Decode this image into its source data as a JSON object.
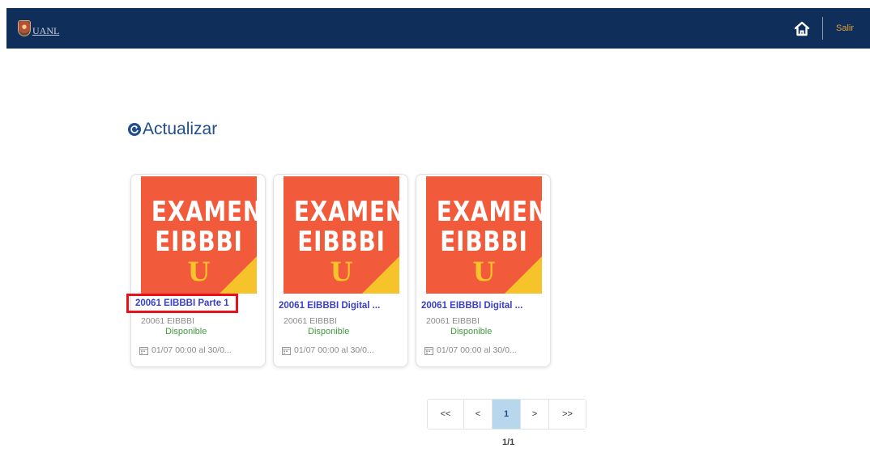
{
  "header": {
    "brand": "UANL",
    "logout_label": "Salir"
  },
  "toolbar": {
    "refresh_label": "Actualizar"
  },
  "cards": [
    {
      "thumb_line1": "EXAMEN",
      "thumb_line2": "EIBBBI",
      "thumb_mark": "U",
      "title": "20061 EIBBBI Parte 1",
      "subtitle": "20061 EIBBBI",
      "status": "Disponible",
      "dates": "01/07 00:00 al 30/0..."
    },
    {
      "thumb_line1": "EXAMEN",
      "thumb_line2": "EIBBBI",
      "thumb_mark": "U",
      "title": "20061 EIBBBI Digital ...",
      "subtitle": "20061 EIBBBI",
      "status": "Disponible",
      "dates": "01/07 00:00 al 30/0..."
    },
    {
      "thumb_line1": "EXAMEN",
      "thumb_line2": "EIBBBI",
      "thumb_mark": "U",
      "title": "20061 EIBBBI Digital ...",
      "subtitle": "20061 EIBBBI",
      "status": "Disponible",
      "dates": "01/07 00:00 al 30/0..."
    }
  ],
  "pagination": {
    "first": "<<",
    "prev": "<",
    "current": "1",
    "next": ">",
    "last": ">>",
    "info": "1/1"
  },
  "colors": {
    "navbar": "#0f2e5a",
    "accent": "#1f4e8a",
    "thumb": "#f15a3b",
    "thumb_accent": "#f7c32b",
    "highlight": "#e8111b",
    "status": "#3d9a3d"
  }
}
